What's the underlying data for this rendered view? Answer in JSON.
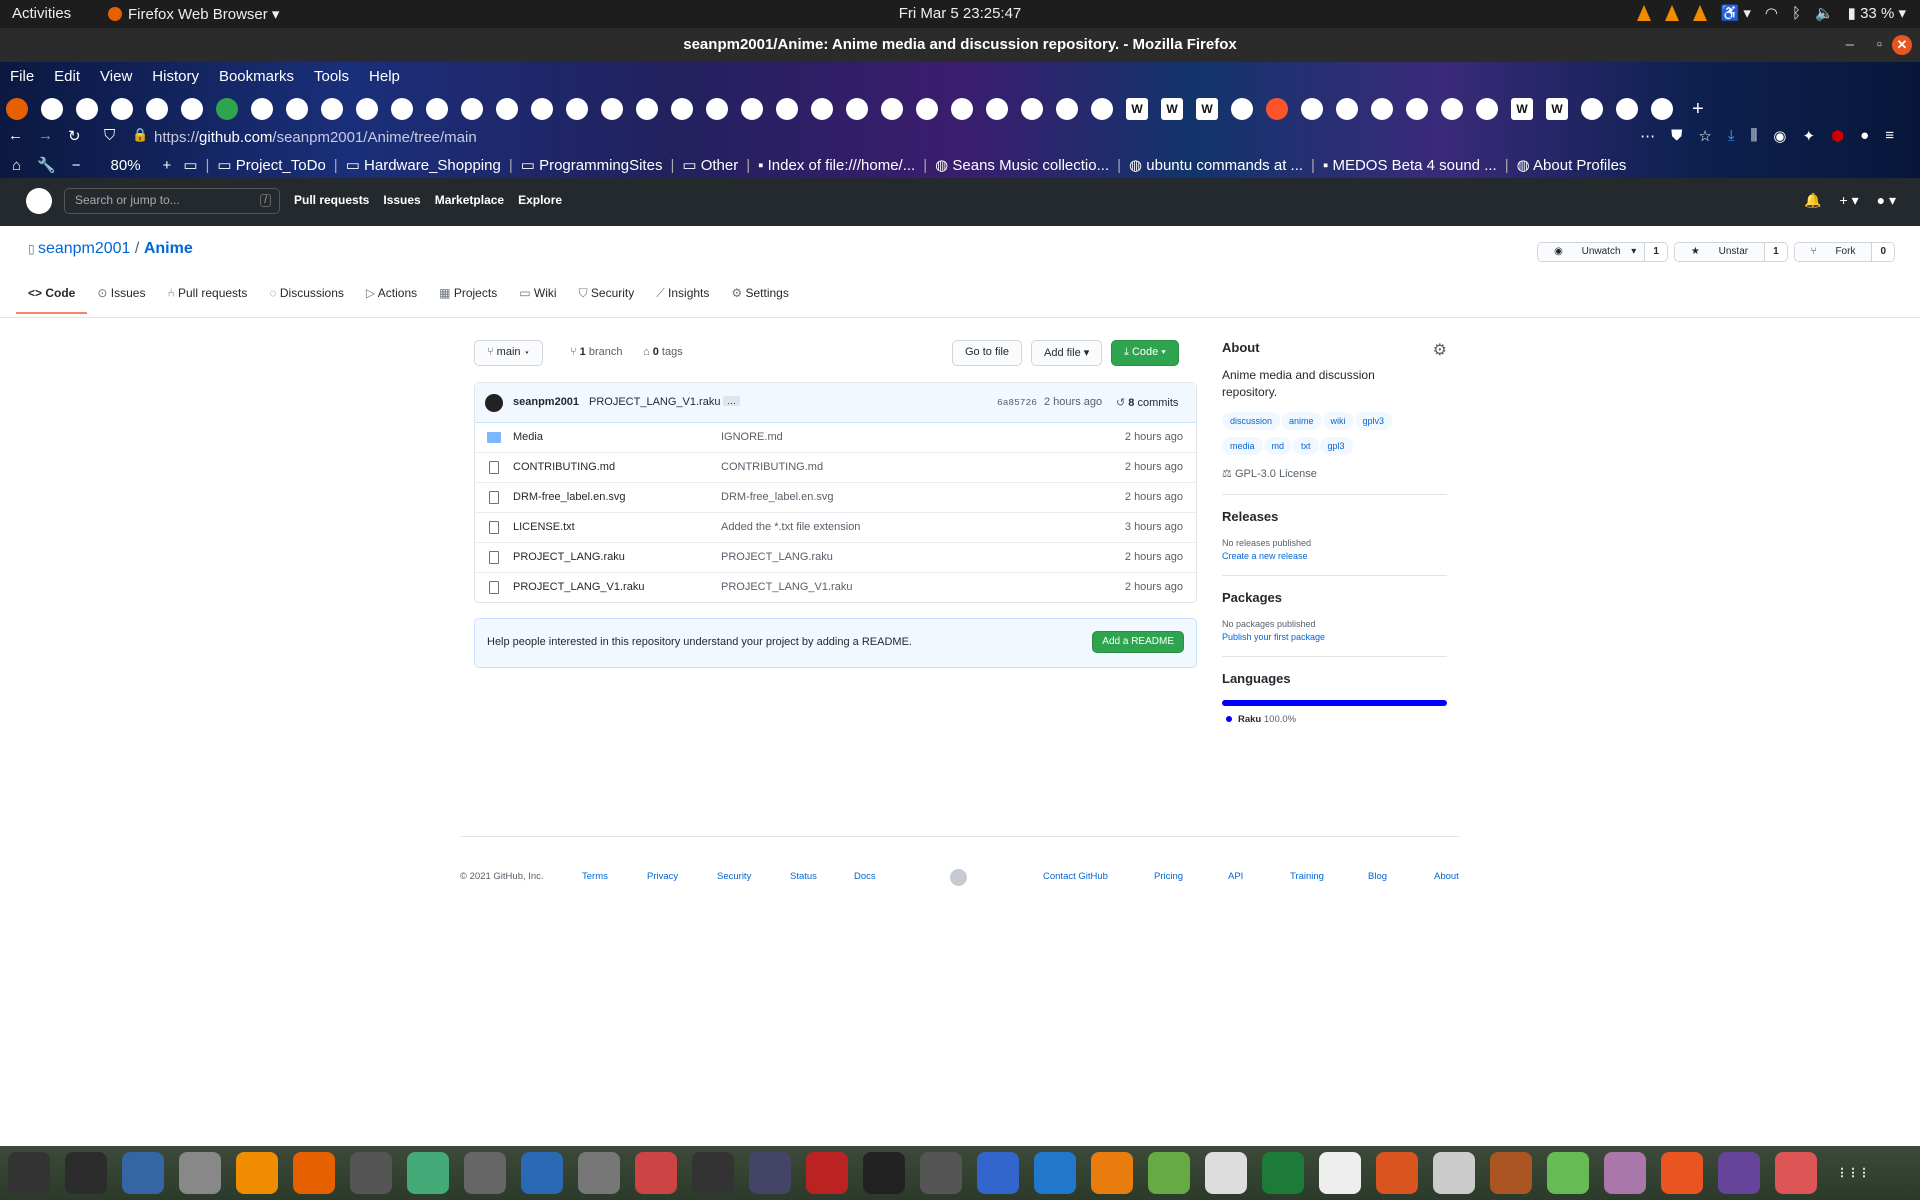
{
  "system": {
    "activities": "Activities",
    "app_name": "Firefox Web Browser",
    "clock": "Fri Mar 5  23:25:47",
    "battery": "33 %"
  },
  "window": {
    "title": "seanpm2001/Anime: Anime media and discussion repository. - Mozilla Firefox"
  },
  "browser": {
    "menu": [
      "File",
      "Edit",
      "View",
      "History",
      "Bookmarks",
      "Tools",
      "Help"
    ],
    "url_prefix": "https://",
    "url_host": "github.com",
    "url_path": "/seanpm2001/Anime/tree/main",
    "zoom": "80%",
    "bookmarks": [
      "Project_ToDo",
      "Hardware_Shopping",
      "ProgrammingSites",
      "Other",
      "Index of file:///home/...",
      "Seans Music collectio...",
      "ubuntu commands at ...",
      "MEDOS Beta 4 sound ...",
      "About Profiles"
    ]
  },
  "github": {
    "search_placeholder": "Search or jump to...",
    "search_key": "/",
    "nav": [
      "Pull requests",
      "Issues",
      "Marketplace",
      "Explore"
    ]
  },
  "repo": {
    "owner": "seanpm2001",
    "separator": "/",
    "name": "Anime",
    "watch_label": "Unwatch",
    "watch_count": "1",
    "star_label": "Unstar",
    "star_count": "1",
    "fork_label": "Fork",
    "fork_count": "0",
    "tabs": [
      "Code",
      "Issues",
      "Pull requests",
      "Discussions",
      "Actions",
      "Projects",
      "Wiki",
      "Security",
      "Insights",
      "Settings"
    ]
  },
  "toolbar": {
    "branch": "main",
    "branch_count": "1",
    "branch_label": "branch",
    "tag_count": "0",
    "tag_label": "tags",
    "goto_file": "Go to file",
    "add_file": "Add file",
    "code": "Code"
  },
  "commit": {
    "author": "seanpm2001",
    "message": "PROJECT_LANG_V1.raku",
    "hash": "6a85726",
    "age": "2 hours ago",
    "count": "8",
    "count_label": "commits"
  },
  "files": [
    {
      "type": "folder",
      "name": "Media",
      "message": "IGNORE.md",
      "age": "2 hours ago"
    },
    {
      "type": "file",
      "name": "CONTRIBUTING.md",
      "message": "CONTRIBUTING.md",
      "age": "2 hours ago"
    },
    {
      "type": "file",
      "name": "DRM-free_label.en.svg",
      "message": "DRM-free_label.en.svg",
      "age": "2 hours ago"
    },
    {
      "type": "file",
      "name": "LICENSE.txt",
      "message": "Added the *.txt file extension",
      "age": "3 hours ago"
    },
    {
      "type": "file",
      "name": "PROJECT_LANG.raku",
      "message": "PROJECT_LANG.raku",
      "age": "2 hours ago"
    },
    {
      "type": "file",
      "name": "PROJECT_LANG_V1.raku",
      "message": "PROJECT_LANG_V1.raku",
      "age": "2 hours ago"
    }
  ],
  "readme": {
    "text": "Help people interested in this repository understand your project by adding a README.",
    "button": "Add a README"
  },
  "about": {
    "heading": "About",
    "description": "Anime media and discussion repository.",
    "topics": [
      "discussion",
      "anime",
      "wiki",
      "gplv3",
      "media",
      "md",
      "txt",
      "gpl3"
    ],
    "license": "GPL-3.0 License"
  },
  "releases": {
    "heading": "Releases",
    "none": "No releases published",
    "create": "Create a new release"
  },
  "packages": {
    "heading": "Packages",
    "none": "No packages published",
    "publish": "Publish your first package"
  },
  "languages": {
    "heading": "Languages",
    "name": "Raku",
    "percent": "100.0%",
    "share": 1.0,
    "color": "#0000fb"
  },
  "footer": {
    "copyright": "© 2021 GitHub, Inc.",
    "links_left": [
      "Terms",
      "Privacy",
      "Security",
      "Status",
      "Docs"
    ],
    "links_right": [
      "Contact GitHub",
      "Pricing",
      "API",
      "Training",
      "Blog",
      "About"
    ]
  }
}
